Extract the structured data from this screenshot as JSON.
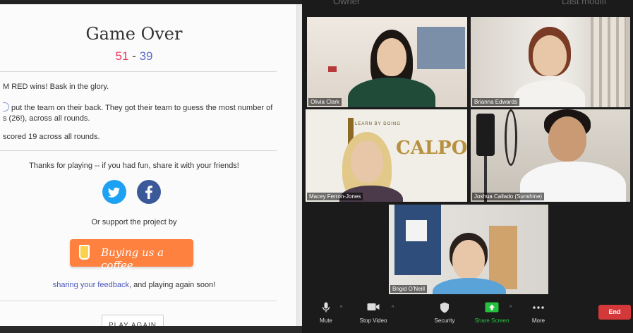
{
  "game": {
    "title": "Game Over",
    "score_red": "51",
    "score_sep": "-",
    "score_blue": "39",
    "winner_line": "M RED wins! Bask in the glory.",
    "mvp_line1": "put the team on their back. They got their team to guess the most number of",
    "mvp_line2": "s (26!), across all rounds.",
    "score_line": "scored 19 across all rounds.",
    "thanks": "Thanks for playing -- if you had fun, share it with your friends!",
    "support": "Or support the project by",
    "coffee_label": "Buying us a coffee",
    "feedback_link": "sharing your feedback",
    "feedback_rest": ", and playing again soon!",
    "play_again": "PLAY AGAIN",
    "twitter_icon": "twitter-icon",
    "facebook_icon": "facebook-icon",
    "coffee_icon": "coffee-cup-icon"
  },
  "gallery": {
    "header_ghost_left": "Owner",
    "header_ghost_right": "Last modifi",
    "participants": [
      {
        "name": "Olivia Clark"
      },
      {
        "name": "Brianna Edwards"
      },
      {
        "name": "Macey Ferron-Jones"
      },
      {
        "name": "Joshua Callado (Sunshine)"
      },
      {
        "name": "Brigid O'Neill"
      }
    ],
    "wall_text": "LEARN BY DOING",
    "wall_sign": "CALPOLY",
    "active_color": "#e6e64a"
  },
  "toolbar": {
    "mute": "Mute",
    "stop_video": "Stop Video",
    "security": "Security",
    "share_screen": "Share Screen",
    "more": "More",
    "end": "End",
    "caret": "^",
    "share_color": "#25c13e",
    "end_color": "#d43838"
  }
}
